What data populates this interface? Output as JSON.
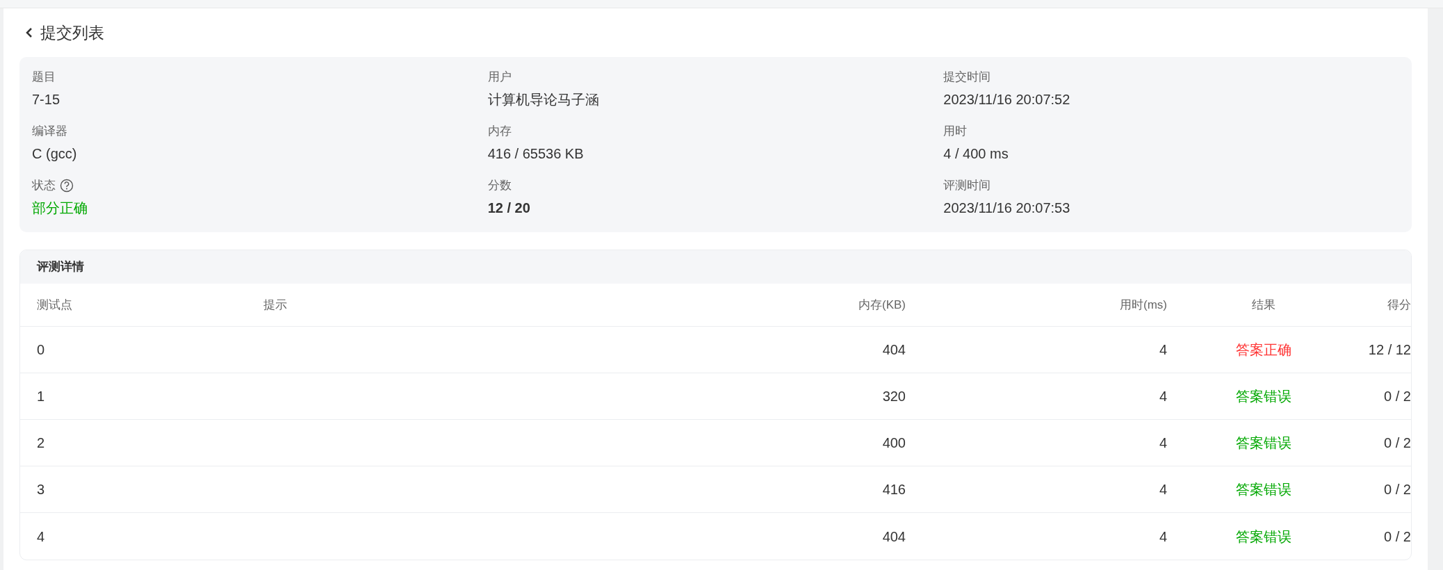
{
  "back_title": "提交列表",
  "info": [
    {
      "label": "题目",
      "value": "7-15",
      "help": false
    },
    {
      "label": "用户",
      "value": "计算机导论马子涵",
      "help": false
    },
    {
      "label": "提交时间",
      "value": "2023/11/16 20:07:52",
      "help": false
    },
    {
      "label": "编译器",
      "value": "C (gcc)",
      "help": false
    },
    {
      "label": "内存",
      "value": "416 / 65536 KB",
      "help": false
    },
    {
      "label": "用时",
      "value": "4 / 400 ms",
      "help": false
    },
    {
      "label": "状态",
      "value": "部分正确",
      "help": true,
      "color": "#00a800"
    },
    {
      "label": "分数",
      "value": "12 / 20",
      "help": false,
      "bold": true
    },
    {
      "label": "评测时间",
      "value": "2023/11/16 20:07:53",
      "help": false
    }
  ],
  "details": {
    "title": "评测详情",
    "columns": [
      "测试点",
      "提示",
      "内存(KB)",
      "用时(ms)",
      "结果",
      "得分"
    ],
    "rows": [
      {
        "case": "0",
        "memory": "404",
        "time": "4",
        "result": "答案正确",
        "color": "#ff3333",
        "score": "12 / 12"
      },
      {
        "case": "1",
        "memory": "320",
        "time": "4",
        "result": "答案错误",
        "color": "#00a800",
        "score": "0 / 2"
      },
      {
        "case": "2",
        "memory": "400",
        "time": "4",
        "result": "答案错误",
        "color": "#00a800",
        "score": "0 / 2"
      },
      {
        "case": "3",
        "memory": "416",
        "time": "4",
        "result": "答案错误",
        "color": "#00a800",
        "score": "0 / 2"
      },
      {
        "case": "4",
        "memory": "404",
        "time": "4",
        "result": "答案错误",
        "color": "#00a800",
        "score": "0 / 2"
      }
    ]
  }
}
